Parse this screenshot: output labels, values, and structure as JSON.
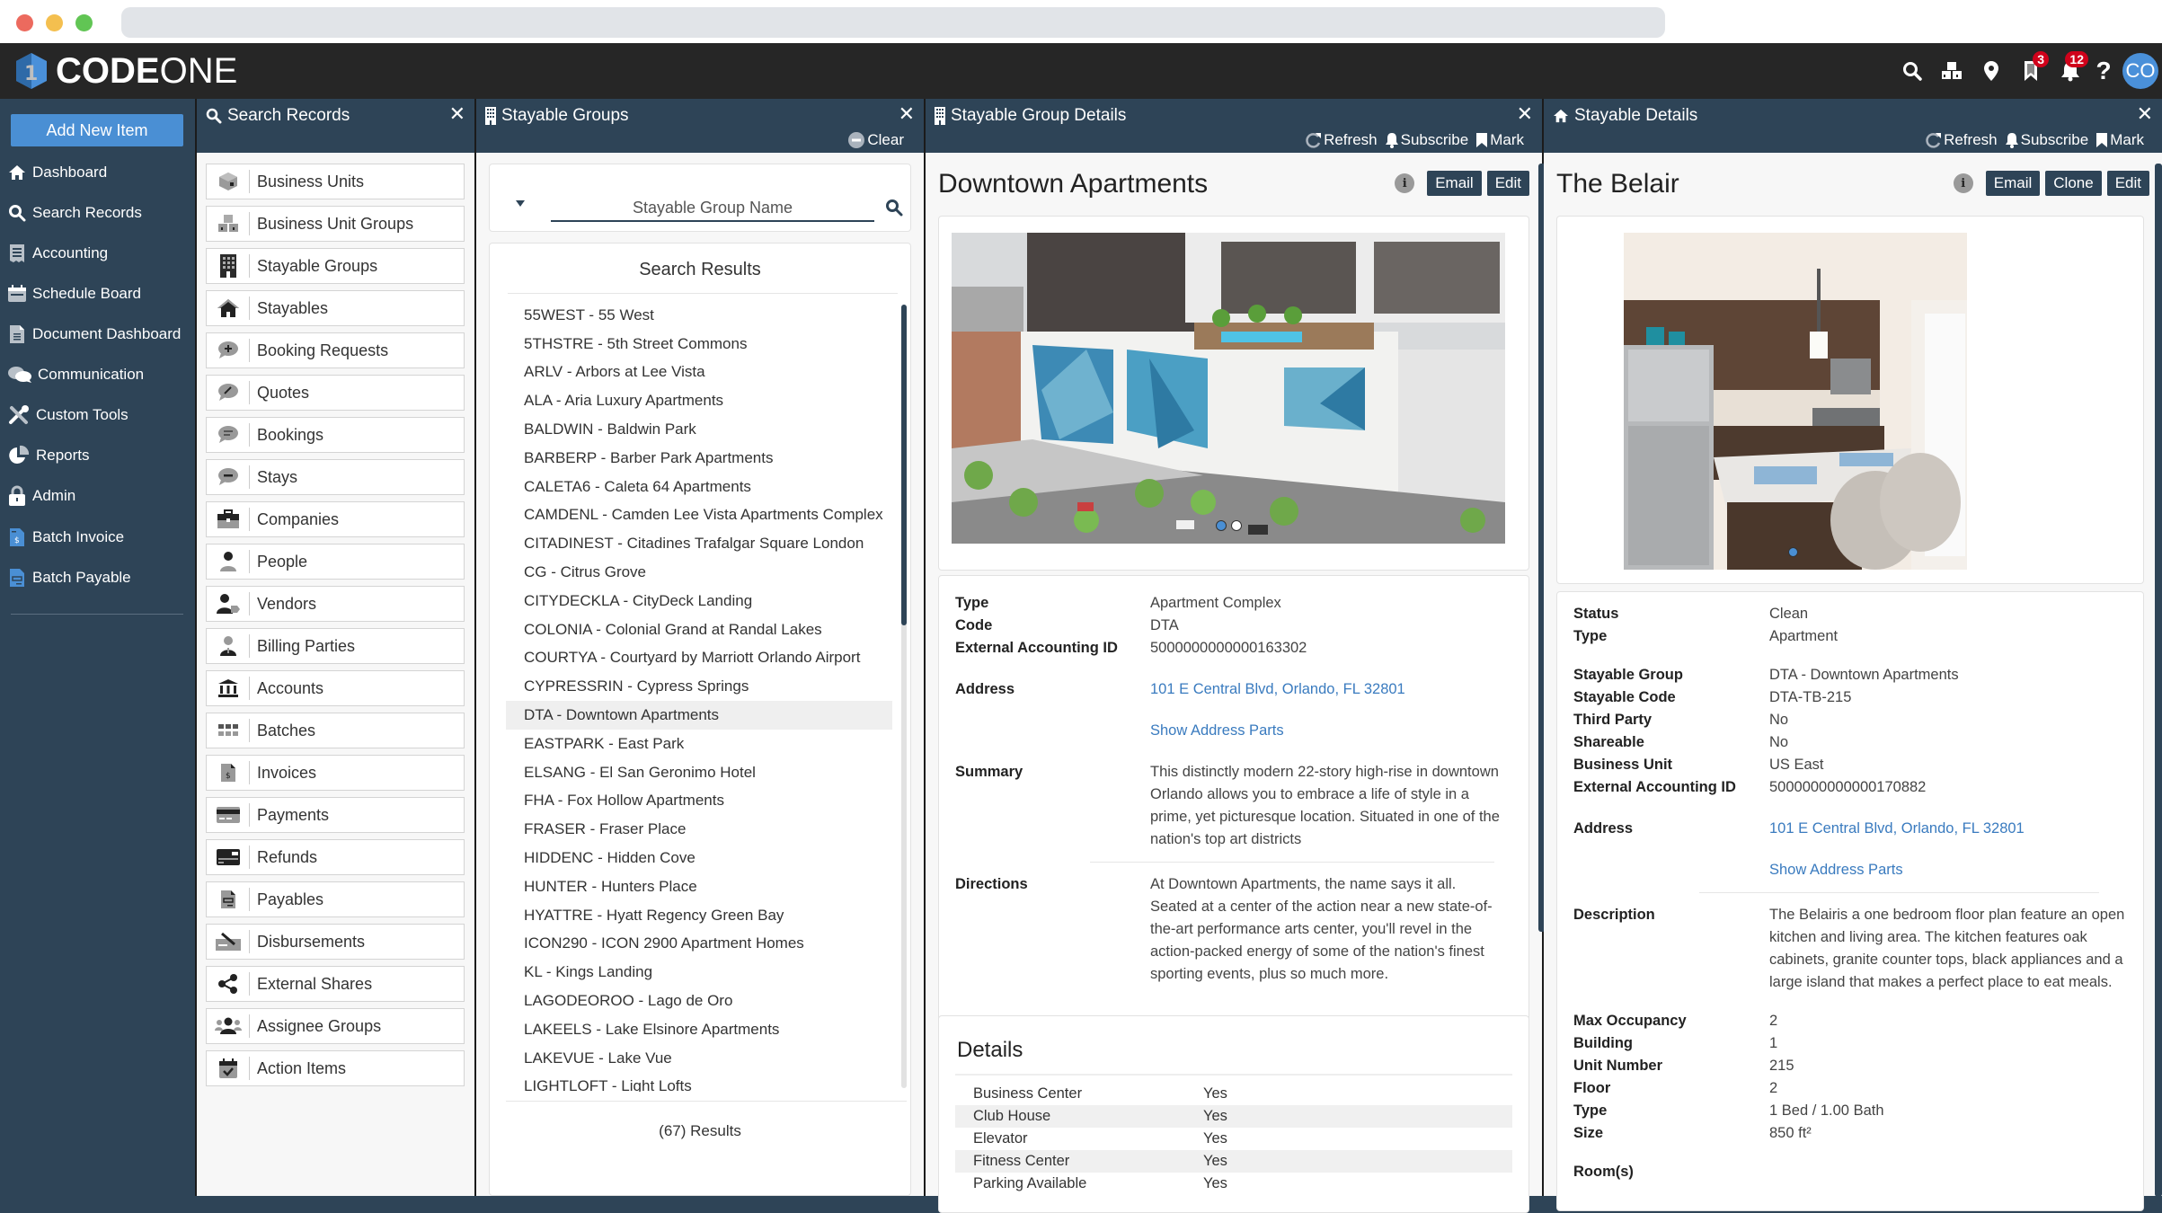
{
  "browser": {
    "address": ""
  },
  "app": {
    "logo_bold": "CODE",
    "logo_light": "ONE"
  },
  "topnav": {
    "icons": [
      "search-icon",
      "cubes-icon",
      "map-marker-icon",
      "bookmark-icon",
      "bell-icon",
      "help-icon"
    ],
    "bookmark_badge": "3",
    "bell_badge": "12",
    "avatar_initials": "CO"
  },
  "sidebar": {
    "add_button": "Add New Item",
    "items": [
      {
        "label": "Dashboard",
        "icon": "home-icon"
      },
      {
        "label": "Search Records",
        "icon": "search-icon"
      },
      {
        "label": "Accounting",
        "icon": "receipt-icon"
      },
      {
        "label": "Schedule Board",
        "icon": "calendar-icon"
      },
      {
        "label": "Document Dashboard",
        "icon": "document-icon"
      },
      {
        "label": "Communication",
        "icon": "chat-icon"
      },
      {
        "label": "Custom Tools",
        "icon": "tools-icon"
      },
      {
        "label": "Reports",
        "icon": "pie-chart-icon"
      },
      {
        "label": "Admin",
        "icon": "lock-icon"
      },
      {
        "label": "Batch Invoice",
        "icon": "invoice-icon"
      },
      {
        "label": "Batch Payable",
        "icon": "payable-icon"
      }
    ]
  },
  "search_records": {
    "title": "Search Records",
    "items": [
      {
        "label": "Business Units",
        "icon": "cube-icon"
      },
      {
        "label": "Business Unit Groups",
        "icon": "cubes-icon"
      },
      {
        "label": "Stayable Groups",
        "icon": "building-icon"
      },
      {
        "label": "Stayables",
        "icon": "home-icon"
      },
      {
        "label": "Booking Requests",
        "icon": "comment-plus-icon"
      },
      {
        "label": "Quotes",
        "icon": "comment-pencil-icon"
      },
      {
        "label": "Bookings",
        "icon": "comment-lines-icon"
      },
      {
        "label": "Stays",
        "icon": "comment-minus-icon"
      },
      {
        "label": "Companies",
        "icon": "briefcase-icon"
      },
      {
        "label": "People",
        "icon": "person-icon"
      },
      {
        "label": "Vendors",
        "icon": "vendor-icon"
      },
      {
        "label": "Billing Parties",
        "icon": "suit-person-icon"
      },
      {
        "label": "Accounts",
        "icon": "bank-icon"
      },
      {
        "label": "Batches",
        "icon": "grid-icon"
      },
      {
        "label": "Invoices",
        "icon": "invoice-icon"
      },
      {
        "label": "Payments",
        "icon": "credit-card-icon"
      },
      {
        "label": "Refunds",
        "icon": "card-refund-icon"
      },
      {
        "label": "Payables",
        "icon": "payable-icon"
      },
      {
        "label": "Disbursements",
        "icon": "check-sign-icon"
      },
      {
        "label": "External Shares",
        "icon": "share-icon"
      },
      {
        "label": "Assignee Groups",
        "icon": "users-icon"
      },
      {
        "label": "Action Items",
        "icon": "calendar-check-icon"
      }
    ]
  },
  "stayable_groups": {
    "title": "Stayable Groups",
    "clear_label": "Clear",
    "search_placeholder": "Stayable Group Name",
    "results_title": "Search Results",
    "results": [
      "55WEST - 55 West",
      "5THSTRE - 5th Street Commons",
      "ARLV - Arbors at Lee Vista",
      "ALA - Aria Luxury Apartments",
      "BALDWIN - Baldwin Park",
      "BARBERP - Barber Park Apartments",
      "CALETA6 - Caleta 64 Apartments",
      "CAMDENL - Camden Lee Vista Apartments Complex",
      "CITADINEST - Citadines Trafalgar Square London",
      "CG - Citrus Grove",
      "CITYDECKLA - CityDeck Landing",
      "COLONIA - Colonial Grand at Randal Lakes",
      "COURTYA - Courtyard by Marriott Orlando Airport",
      "CYPRESSRIN - Cypress Springs",
      "DTA - Downtown Apartments",
      "EASTPARK - East Park",
      "ELSANG - El San Geronimo Hotel",
      "FHA - Fox Hollow Apartments",
      "FRASER - Fraser Place",
      "HIDDENC - Hidden Cove",
      "HUNTER - Hunters Place",
      "HYATTRE - Hyatt Regency Green Bay",
      "ICON290 - ICON 2900 Apartment Homes",
      "KL - Kings Landing",
      "LAGODEOROO - Lago de Oro",
      "LAKEELS - Lake Elsinore Apartments",
      "LAKEVUE - Lake Vue",
      "LIGHTLOFT - Light Lofts"
    ],
    "selected_index": 14,
    "results_count": "(67) Results",
    "scroll_position_fraction": 0.0
  },
  "group_details": {
    "panel_title": "Stayable Group Details",
    "actions": [
      "Refresh",
      "Subscribe",
      "Mark"
    ],
    "title": "Downtown Apartments",
    "buttons": [
      "Email",
      "Edit"
    ],
    "image_alt": "Rendering of Downtown Apartments building with rooftop pool",
    "carousel": {
      "count": 2,
      "active": 0
    },
    "fields": {
      "type_label": "Type",
      "type": "Apartment Complex",
      "code_label": "Code",
      "code": "DTA",
      "ext_label": "External Accounting ID",
      "ext": "5000000000000163302",
      "address_label": "Address",
      "address": "101 E Central Blvd, Orlando, FL 32801",
      "show_parts": "Show Address Parts",
      "summary_label": "Summary",
      "summary": "This distinctly modern 22-story high-rise in downtown Orlando allows you to embrace a life of style in a prime, yet picturesque location. Situated in one of the nation's top art districts",
      "directions_label": "Directions",
      "directions": "At Downtown Apartments, the name says it all. Seated at a center of the action near a new state-of-the-art performance arts center, you'll revel in the action-packed energy of some of the nation's finest sporting events, plus so much more."
    },
    "details_title": "Details",
    "amenities": [
      {
        "name": "Business Center",
        "value": "Yes"
      },
      {
        "name": "Club House",
        "value": "Yes"
      },
      {
        "name": "Elevator",
        "value": "Yes"
      },
      {
        "name": "Fitness Center",
        "value": "Yes"
      },
      {
        "name": "Parking Available",
        "value": "Yes"
      }
    ]
  },
  "stayable_details": {
    "panel_title": "Stayable Details",
    "actions": [
      "Refresh",
      "Subscribe",
      "Mark"
    ],
    "title": "The Belair",
    "buttons": [
      "Email",
      "Clone",
      "Edit"
    ],
    "image_alt": "Kitchen with stainless steel appliances and island",
    "carousel": {
      "count": 1,
      "active": 0
    },
    "fields": {
      "status_label": "Status",
      "status": "Clean",
      "type_label": "Type",
      "type": "Apartment",
      "group_label": "Stayable Group",
      "group": "DTA - Downtown Apartments",
      "code_label": "Stayable Code",
      "code": "DTA-TB-215",
      "third_label": "Third Party",
      "third": "No",
      "share_label": "Shareable",
      "share": "No",
      "bu_label": "Business Unit",
      "bu": "US East",
      "ext_label": "External Accounting ID",
      "ext": "5000000000000170882",
      "address_label": "Address",
      "address": "101 E Central Blvd, Orlando, FL 32801",
      "show_parts": "Show Address Parts",
      "desc_label": "Description",
      "desc": "The Belairis a one bedroom floor plan feature an open kitchen and living area. The kitchen features oak cabinets, granite counter tops, black appliances and a large island that makes a perfect place to eat meals.",
      "maxocc_label": "Max Occupancy",
      "maxocc": "2",
      "building_label": "Building",
      "building": "1",
      "unit_label": "Unit Number",
      "unit": "215",
      "floor_label": "Floor",
      "floor": "2",
      "bedbath_label": "Type",
      "bedbath": "1 Bed / 1.00 Bath",
      "size_label": "Size",
      "size": "850 ft²",
      "rooms_label": "Room(s)"
    }
  },
  "colors": {
    "navy": "#2e4457",
    "topbar": "#262626",
    "accent_blue": "#4a8fd4",
    "link": "#3a7bbf",
    "badge_red": "#d0021b"
  }
}
